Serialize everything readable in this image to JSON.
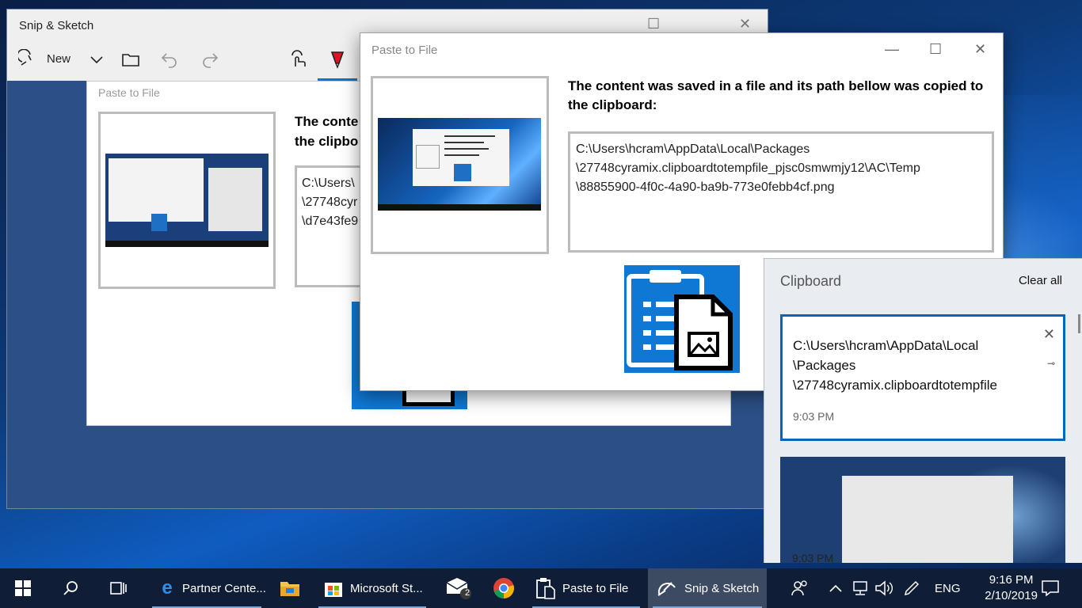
{
  "snip_window": {
    "title": "Snip & Sketch",
    "toolbar": {
      "new_label": "New"
    },
    "canvas": {
      "title": "Paste to File",
      "message": "The conte\nthe clipbo",
      "path": "C:\\Users\\\n\\27748cyr\n\\d7e43fe9"
    }
  },
  "paste_window": {
    "title": "Paste to File",
    "message": "The content was saved in a file and its path bellow was copied to the clipboard:",
    "path_lines": [
      "C:\\Users\\hcram\\AppData\\Local\\Packages",
      "\\27748cyramix.clipboardtotempfile_pjsc0smwmjy12\\AC\\Temp",
      "\\88855900-4f0c-4a90-ba9b-773e0febb4cf.png"
    ]
  },
  "clipboard": {
    "title": "Clipboard",
    "clear_all": "Clear all",
    "items": [
      {
        "text": "C:\\Users\\hcram\\AppData\\Local\n\\Packages\n\\27748cyramix.clipboardtotempfile",
        "time": "9:03 PM"
      },
      {
        "time": "9:03 PM"
      }
    ]
  },
  "taskbar": {
    "apps": [
      {
        "label": "Partner Cente..."
      },
      {
        "label": "Microsoft St..."
      },
      {
        "label": "Paste to File"
      },
      {
        "label": "Snip & Sketch"
      }
    ],
    "mail_badge": "2",
    "language": "ENG",
    "time": "9:16 PM",
    "date": "2/10/2019"
  },
  "colors": {
    "accent": "#0078d7",
    "taskbar": "#0f1d36"
  }
}
